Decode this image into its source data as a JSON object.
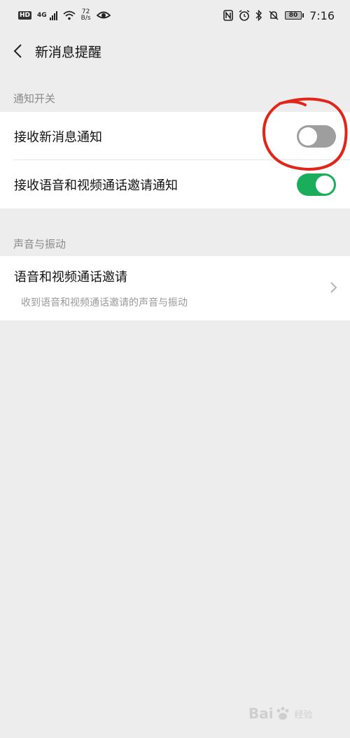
{
  "status_bar": {
    "hd": "HD",
    "network": "4G",
    "speed_value": "72",
    "speed_unit": "B/s",
    "battery": "80",
    "time": "7:16"
  },
  "header": {
    "title": "新消息提醒"
  },
  "sections": {
    "notify": {
      "title": "通知开关",
      "items": [
        {
          "label": "接收新消息通知",
          "toggle": "off"
        },
        {
          "label": "接收语音和视频通话邀请通知",
          "toggle": "on"
        }
      ]
    },
    "sound": {
      "title": "声音与振动",
      "item": {
        "label": "语音和视频通话邀请",
        "sublabel": "收到语音和视频通话邀请的声音与振动"
      }
    }
  },
  "colors": {
    "toggle_on": "#1aad5b",
    "toggle_off": "#9e9e9e",
    "annotation": "#e0261b"
  },
  "watermark": {
    "brand": "Bai",
    "suffix": "经验"
  }
}
